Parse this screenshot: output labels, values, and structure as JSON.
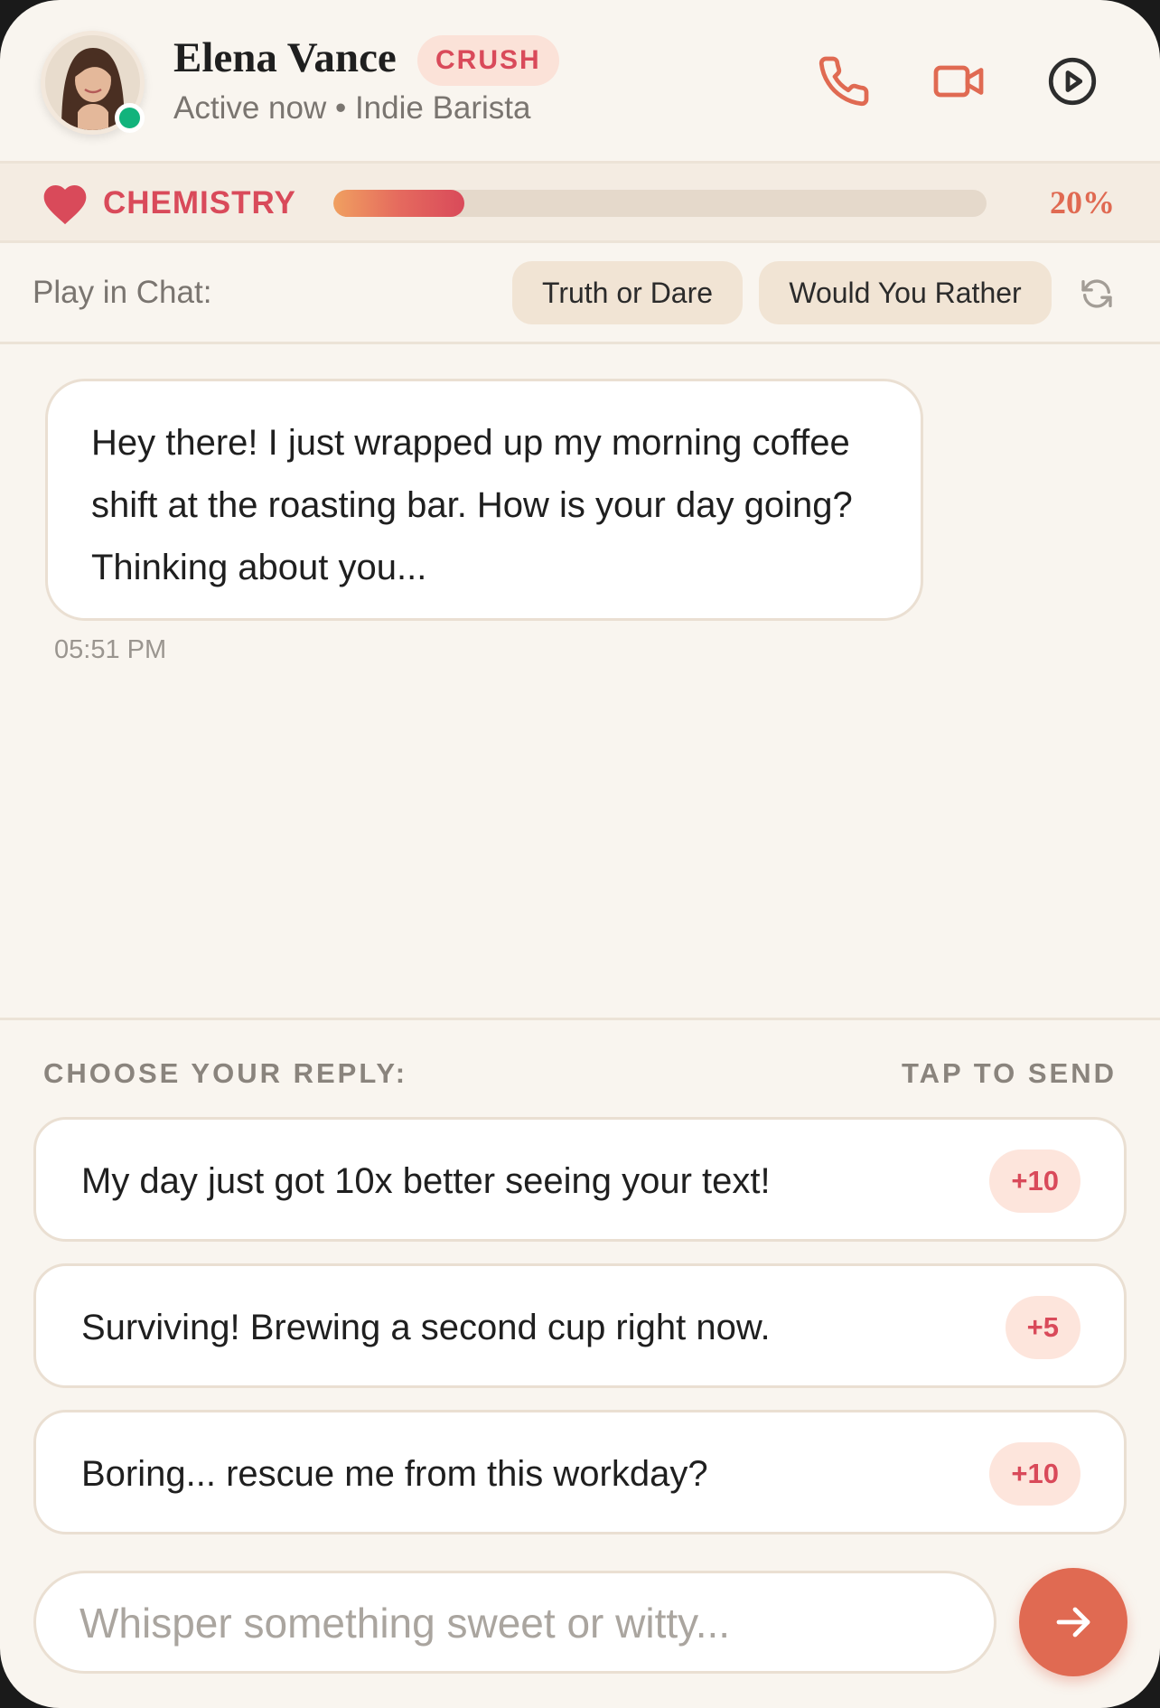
{
  "header": {
    "name": "Elena Vance",
    "badge": "CRUSH",
    "subtitle": "Active now • Indie Barista",
    "status": "online",
    "icons": [
      "phone-icon",
      "video-icon",
      "play-circle-icon"
    ]
  },
  "chemistry": {
    "label": "CHEMISTRY",
    "percent_label": "20%",
    "level": 0.2
  },
  "games": {
    "label": "Play in Chat:",
    "options": [
      "Truth or Dare",
      "Would You Rather"
    ]
  },
  "messages": [
    {
      "text": "Hey there! I just wrapped up my morning coffee shift at the roasting bar. How is your day going? Thinking about you...",
      "time": "05:51 PM"
    }
  ],
  "replies": {
    "title": "CHOOSE YOUR REPLY:",
    "hint": "TAP TO SEND",
    "options": [
      {
        "text": "My day just got 10x better seeing your text!",
        "points": "+10"
      },
      {
        "text": "Surviving! Brewing a second cup right now.",
        "points": "+5"
      },
      {
        "text": "Boring... rescue me from this workday?",
        "points": "+10"
      }
    ]
  },
  "composer": {
    "placeholder": "Whisper something sweet or witty...",
    "value": ""
  },
  "colors": {
    "accent": "#e06a52",
    "brand_pink": "#d94a5a",
    "online": "#12b37c",
    "background": "#f9f5ef"
  }
}
